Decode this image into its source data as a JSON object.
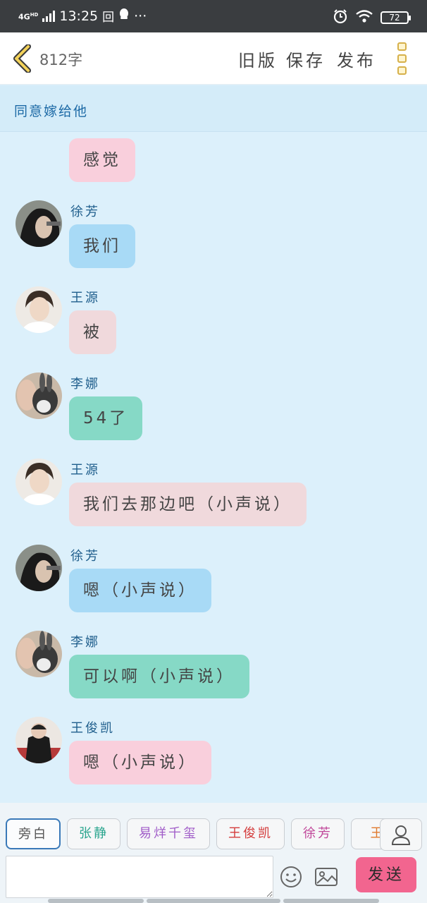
{
  "status_bar": {
    "network": "4G",
    "network_sub": "HD",
    "time": "13:25",
    "notif_box": "回",
    "more": "···",
    "battery": "72"
  },
  "header": {
    "word_count": "812字",
    "old_version": "旧版",
    "save": "保存",
    "publish": "发布"
  },
  "story_title": "同意嫁给他",
  "messages": [
    {
      "sender": "",
      "text": "感觉",
      "bubble_color": "#f9cfdc",
      "avatar": "avatar-wangjunkai"
    },
    {
      "sender": "徐芳",
      "text": "我们",
      "bubble_color": "#a8daf6",
      "avatar": "avatar-xufang"
    },
    {
      "sender": "王源",
      "text": "被",
      "bubble_color": "#f0d9dc",
      "avatar": "avatar-wangyuan"
    },
    {
      "sender": "李娜",
      "text": "54了",
      "bubble_color": "#86d9c6",
      "avatar": "avatar-lina"
    },
    {
      "sender": "王源",
      "text": "我们去那边吧（小声说）",
      "bubble_color": "#f0d9dc",
      "avatar": "avatar-wangyuan"
    },
    {
      "sender": "徐芳",
      "text": "嗯（小声说）",
      "bubble_color": "#a8daf6",
      "avatar": "avatar-xufang"
    },
    {
      "sender": "李娜",
      "text": "可以啊（小声说）",
      "bubble_color": "#86d9c6",
      "avatar": "avatar-lina"
    },
    {
      "sender": "王俊凯",
      "text": "嗯（小声说）",
      "bubble_color": "#f9cfdc",
      "avatar": "avatar-wangjunkai"
    }
  ],
  "roles": [
    {
      "label": "旁白",
      "color": "#555555"
    },
    {
      "label": "张静",
      "color": "#2aa58e"
    },
    {
      "label": "易烊千玺",
      "color": "#a05cc8"
    },
    {
      "label": "王俊凯",
      "color": "#d43c3c"
    },
    {
      "label": "徐芳",
      "color": "#c0479a"
    },
    {
      "label": "王",
      "color": "#e07a2e"
    }
  ],
  "composer": {
    "placeholder": "",
    "send_label": "发送"
  },
  "colors": {
    "accent": "#f2658f",
    "background": "#dcf0fb",
    "title_text": "#1d6aa6"
  }
}
